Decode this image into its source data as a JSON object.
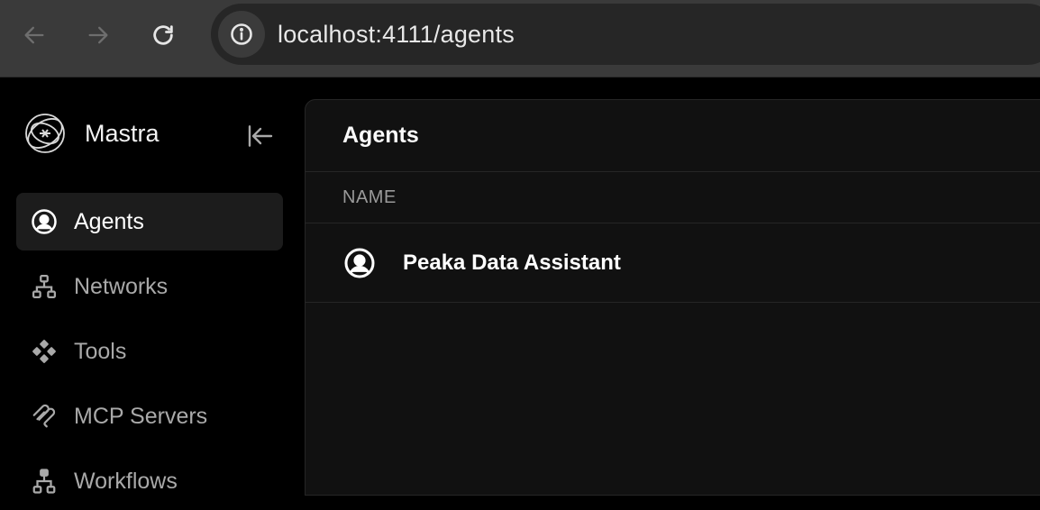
{
  "browser": {
    "url": "localhost:4111/agents",
    "back_icon": "arrow-left-icon",
    "forward_icon": "arrow-right-icon",
    "reload_icon": "reload-icon",
    "site_info_icon": "info-icon"
  },
  "sidebar": {
    "brand": {
      "name": "Mastra",
      "logo_icon": "mastra-logo-icon"
    },
    "collapse_icon": "collapse-sidebar-icon",
    "items": [
      {
        "label": "Agents",
        "icon": "agent-user-icon",
        "active": true
      },
      {
        "label": "Networks",
        "icon": "network-icon",
        "active": false
      },
      {
        "label": "Tools",
        "icon": "tools-icon",
        "active": false
      },
      {
        "label": "MCP Servers",
        "icon": "mcp-icon",
        "active": false
      },
      {
        "label": "Workflows",
        "icon": "workflow-icon",
        "active": false
      }
    ]
  },
  "main": {
    "title": "Agents",
    "table": {
      "columns": [
        "NAME"
      ],
      "rows": [
        {
          "name": "Peaka Data Assistant",
          "icon": "agent-user-icon"
        }
      ]
    }
  },
  "colors": {
    "background": "#000000",
    "panel": "#111111",
    "active_item": "#1c1c1c",
    "chrome": "#3a3a3a",
    "muted_text": "#a9a9a9"
  }
}
